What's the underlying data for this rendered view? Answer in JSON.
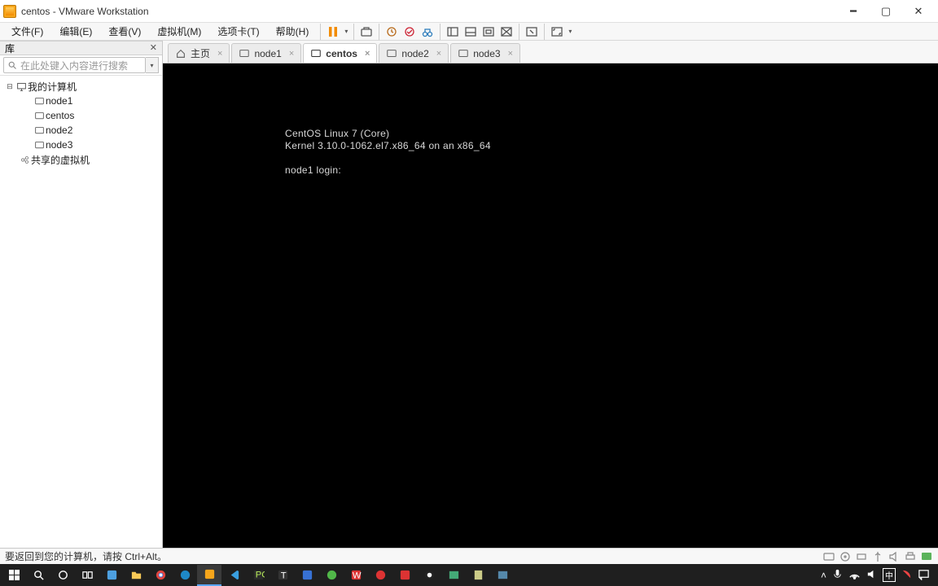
{
  "window": {
    "title": "centos - VMware Workstation"
  },
  "menu": {
    "file": "文件(F)",
    "edit": "编辑(E)",
    "view": "查看(V)",
    "vm": "虚拟机(M)",
    "tabs": "选项卡(T)",
    "help": "帮助(H)"
  },
  "library": {
    "header": "库",
    "search_placeholder": "在此处键入内容进行搜索",
    "root": "我的计算机",
    "items": [
      "node1",
      "centos",
      "node2",
      "node3"
    ],
    "shared": "共享的虚拟机"
  },
  "tabs": {
    "home": "主页",
    "t1": "node1",
    "t2": "centos",
    "t3": "node2",
    "t4": "node3"
  },
  "console": {
    "l1": "CentOS Linux 7 (Core)",
    "l2": "Kernel 3.10.0-1062.el7.x86_64 on an x86_64",
    "l3": "",
    "l4": "node1 login:"
  },
  "status": {
    "hint": "要返回到您的计算机，请按 Ctrl+Alt。"
  },
  "tray": {
    "ime": "中"
  }
}
